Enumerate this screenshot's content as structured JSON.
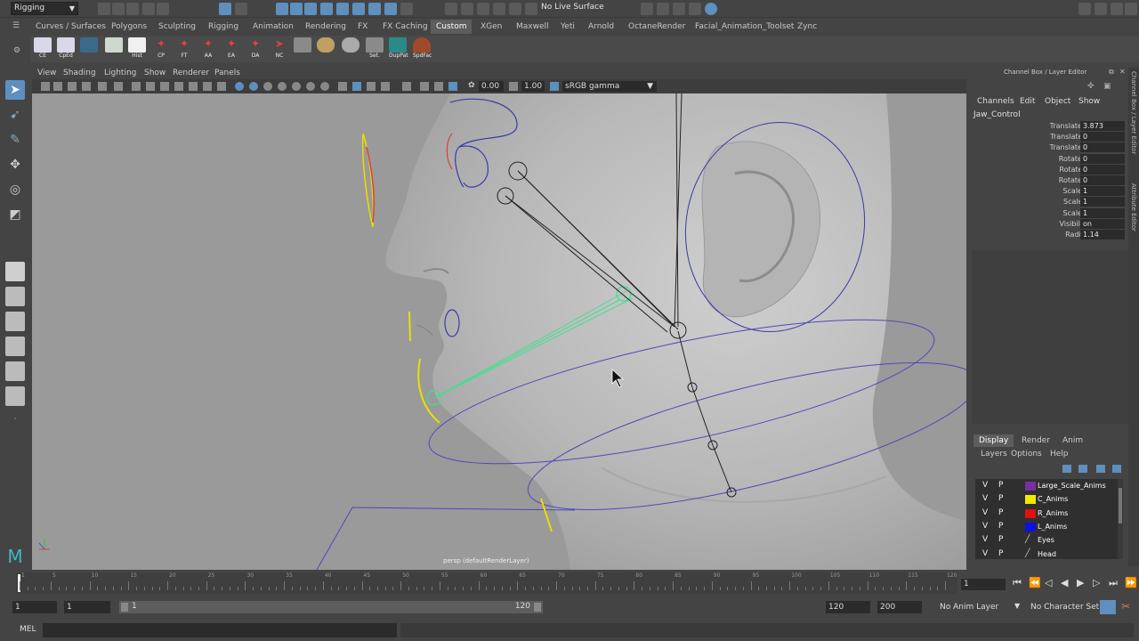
{
  "top": {
    "mode": "Rigging",
    "live_surface": "No Live Surface"
  },
  "shelf_tabs": [
    "Curves / Surfaces",
    "Polygons",
    "Sculpting",
    "Rigging",
    "Animation",
    "Rendering",
    "FX",
    "FX Caching",
    "Custom",
    "XGen",
    "Maxwell",
    "Yeti",
    "Arnold",
    "OctaneRender",
    "Facial_Animation_Toolset",
    "Zync"
  ],
  "shelf_items": [
    "CE",
    "CpEd",
    "",
    "",
    "Hist",
    "CP",
    "FT",
    "AA",
    "EA",
    "DA",
    "NC",
    "",
    "",
    "Set.",
    "DupPat",
    "SpdFac"
  ],
  "panel_menu": [
    "View",
    "Shading",
    "Lighting",
    "Show",
    "Renderer",
    "Panels"
  ],
  "panel_toolbar": {
    "exposure": "0.00",
    "gamma": "1.00",
    "color_space": "sRGB gamma"
  },
  "viewport": {
    "label": "persp (defaultRenderLayer)"
  },
  "channel_box": {
    "title": "Channel Box / Layer Editor",
    "menu": [
      "Channels",
      "Edit",
      "Object",
      "Show"
    ],
    "object": "Jaw_Control",
    "attributes": [
      {
        "name": "Translate X",
        "value": "3.873"
      },
      {
        "name": "Translate Y",
        "value": "0"
      },
      {
        "name": "Translate Z",
        "value": "0"
      },
      {
        "name": "Rotate X",
        "value": "0"
      },
      {
        "name": "Rotate Y",
        "value": "0"
      },
      {
        "name": "Rotate Z",
        "value": "0"
      },
      {
        "name": "Scale X",
        "value": "1"
      },
      {
        "name": "Scale Y",
        "value": "1"
      },
      {
        "name": "Scale Z",
        "value": "1"
      },
      {
        "name": "Visibility",
        "value": "on"
      },
      {
        "name": "Radius",
        "value": "1.14"
      }
    ]
  },
  "layer_editor": {
    "tabs": [
      "Display",
      "Render",
      "Anim"
    ],
    "menu": [
      "Layers",
      "Options",
      "Help"
    ],
    "layers": [
      {
        "v": "V",
        "p": "P",
        "color": "#7a2fa0",
        "name": "Large_Scale_Anims"
      },
      {
        "v": "V",
        "p": "P",
        "color": "#f2e800",
        "name": "C_Anims"
      },
      {
        "v": "V",
        "p": "P",
        "color": "#e01010",
        "name": "R_Anims"
      },
      {
        "v": "V",
        "p": "P",
        "color": "#1010e0",
        "name": "L_Anims"
      },
      {
        "v": "V",
        "p": "P",
        "color": "",
        "name": "Eyes"
      },
      {
        "v": "V",
        "p": "P",
        "color": "",
        "name": "Head"
      }
    ]
  },
  "right_strip": [
    "Channel Box / Layer Editor",
    "Attribute Editor"
  ],
  "timeline": {
    "ticks": [
      "1",
      "5",
      "10",
      "15",
      "20",
      "25",
      "30",
      "35",
      "40",
      "45",
      "50",
      "55",
      "60",
      "65",
      "70",
      "75",
      "80",
      "85",
      "90",
      "95",
      "100",
      "105",
      "110",
      "115",
      "120"
    ],
    "current_frame": "1"
  },
  "range": {
    "start": "1",
    "playback_start": "1",
    "slider_start": "1",
    "slider_end": "120",
    "playback_end": "120",
    "end": "200",
    "anim_layer": "No Anim Layer",
    "char_set": "No Character Set"
  },
  "command": {
    "label": "MEL"
  },
  "colors": {
    "accent": "#5d8fbf",
    "viewport_bg": "#9a9a9a",
    "panel_bg": "#444444",
    "curve_blue": "#3a3aa8",
    "curve_yellow": "#e8e000",
    "curve_green": "#40e090"
  }
}
